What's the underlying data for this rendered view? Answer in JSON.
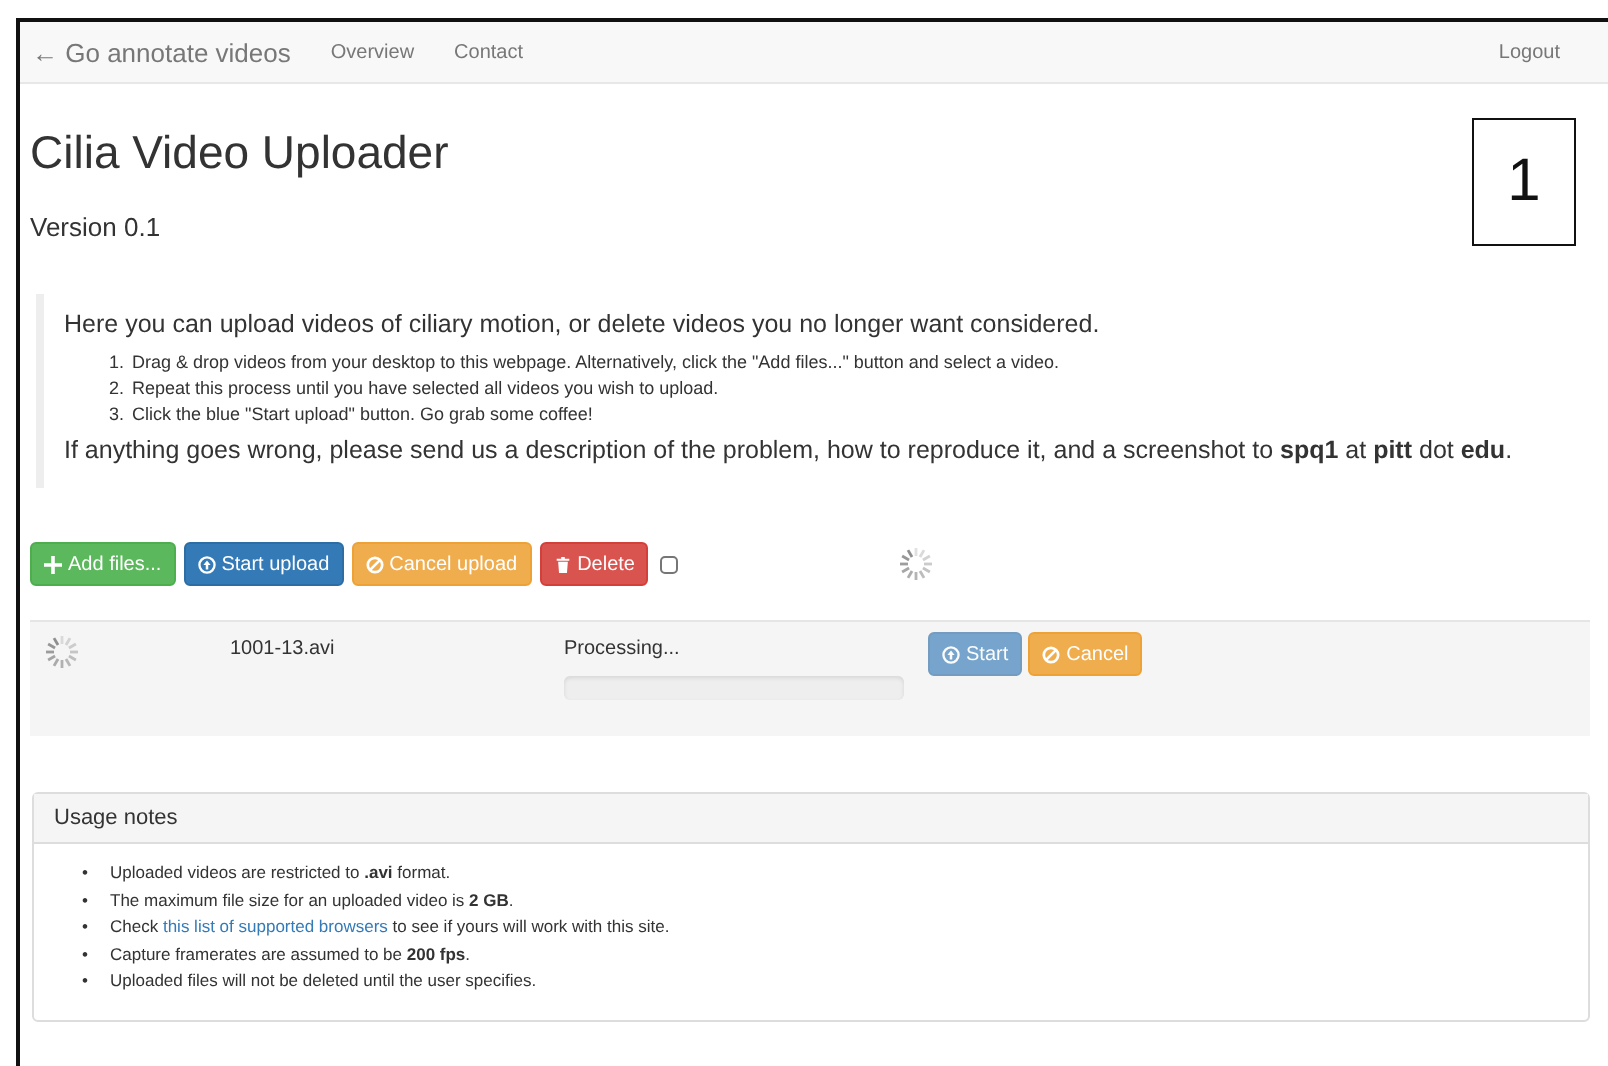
{
  "navbar": {
    "brand": "← Go annotate videos",
    "links": [
      "Overview",
      "Contact"
    ],
    "logout": "Logout"
  },
  "title": "Cilia Video Uploader",
  "version": "Version 0.1",
  "figure_label": "1",
  "intro": {
    "lead": "Here you can upload videos of ciliary motion, or delete videos you no longer want considered.",
    "steps": [
      {
        "marker": "1.",
        "text": "Drag & drop videos from your desktop to this webpage. Alternatively, click the \"Add files...\" button and select a video."
      },
      {
        "marker": "2.",
        "text": "Repeat this process until you have selected all videos you wish to upload."
      },
      {
        "marker": "3.",
        "text": "Click the blue \"Start upload\" button. Go grab some coffee!"
      }
    ],
    "contact": "If anything goes wrong, please send us a description of the problem, how to reproduce it, and a screenshot to **spq1** at **pitt** dot **edu**."
  },
  "toolbar": {
    "buttons": [
      {
        "kind": "add",
        "label": "Add files..."
      },
      {
        "kind": "start",
        "label": "Start upload"
      },
      {
        "kind": "cancel",
        "label": "Cancel upload"
      },
      {
        "kind": "delete",
        "label": "Delete"
      }
    ],
    "select_all": {
      "checked": false
    }
  },
  "files": [
    {
      "name": "1001-13.avi",
      "status": "Processing...",
      "level": 0,
      "buttons": [
        {
          "kind": "start",
          "label": "Start",
          "disabled": true
        },
        {
          "kind": "cancel",
          "label": "Cancel",
          "disabled": false
        }
      ]
    }
  ],
  "usage_notes": {
    "heading": "Usage notes",
    "items": [
      {
        "marker": "•",
        "text": "Uploaded videos are restricted to **.avi** format."
      },
      {
        "marker": "•",
        "text": "The maximum file size for an uploaded video is **2 GB**."
      },
      {
        "marker": "•",
        "text": "Check ",
        "link": "this list of supported browsers",
        "after": " to see if yours will work with this site."
      },
      {
        "marker": "•",
        "text": "Capture framerates are assumed to be **200 fps**."
      },
      {
        "marker": "•",
        "text": "Uploaded files will not be deleted until the user specifies."
      }
    ]
  }
}
